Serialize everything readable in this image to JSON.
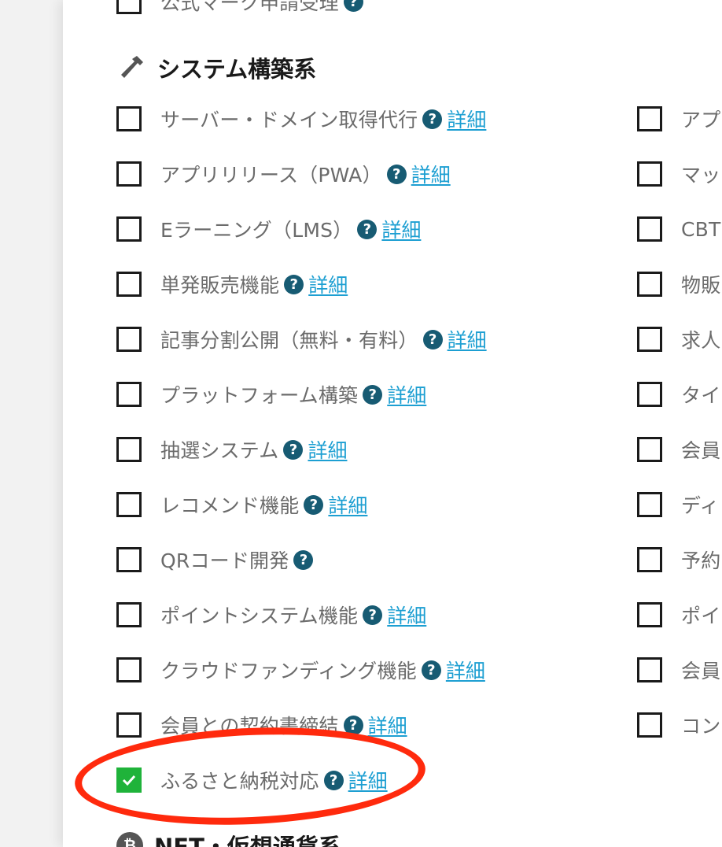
{
  "top_item": {
    "label": "公式マーク申請受理"
  },
  "section_system": {
    "title": "システム構築系",
    "icon": "hammer-icon"
  },
  "section_nft": {
    "title": "NFT・仮想通貨系",
    "icon": "bitcoin-icon"
  },
  "help_glyph": "?",
  "detail_text": "詳細",
  "check_glyph": "✓",
  "left_items": [
    {
      "label": "サーバー・ドメイン取得代行",
      "checked": false,
      "has_detail": true
    },
    {
      "label": "アプリリリース（PWA）",
      "checked": false,
      "has_detail": true
    },
    {
      "label": "Eラーニング（LMS）",
      "checked": false,
      "has_detail": true
    },
    {
      "label": "単発販売機能",
      "checked": false,
      "has_detail": true
    },
    {
      "label": "記事分割公開（無料・有料）",
      "checked": false,
      "has_detail": true
    },
    {
      "label": "プラットフォーム構築",
      "checked": false,
      "has_detail": true
    },
    {
      "label": "抽選システム",
      "checked": false,
      "has_detail": true
    },
    {
      "label": "レコメンド機能",
      "checked": false,
      "has_detail": true
    },
    {
      "label": "QRコード開発",
      "checked": false,
      "has_detail": false
    },
    {
      "label": "ポイントシステム機能",
      "checked": false,
      "has_detail": true
    },
    {
      "label": "クラウドファンディング機能",
      "checked": false,
      "has_detail": true
    },
    {
      "label": "会員との契約書締結",
      "checked": false,
      "has_detail": true
    },
    {
      "label": "ふるさと納税対応",
      "checked": true,
      "has_detail": true
    }
  ],
  "right_items": [
    {
      "label": "アプ"
    },
    {
      "label": "マッ"
    },
    {
      "label": "CBT"
    },
    {
      "label": "物販"
    },
    {
      "label": "求人"
    },
    {
      "label": "タイ"
    },
    {
      "label": "会員"
    },
    {
      "label": "ディ"
    },
    {
      "label": "予約"
    },
    {
      "label": "ポイ"
    },
    {
      "label": "会員"
    },
    {
      "label": "コン"
    }
  ],
  "colors": {
    "checkbox_checked": "#1fb33a",
    "help_badge": "#175b73",
    "detail_link": "#1d9fd2",
    "highlight_ellipse": "#ff2a0d"
  }
}
